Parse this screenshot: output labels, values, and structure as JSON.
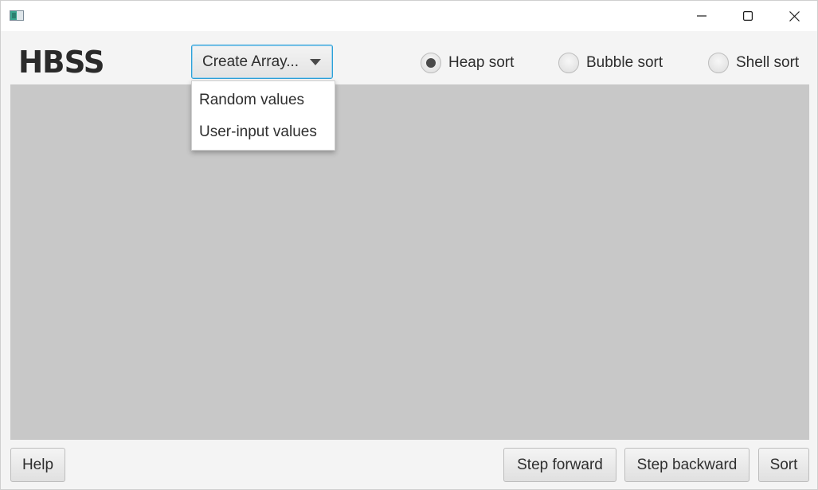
{
  "window": {
    "app_icon": "app-window-icon",
    "controls": {
      "minimize": "minimize-icon",
      "maximize": "maximize-icon",
      "close": "close-icon"
    }
  },
  "header": {
    "logo": "HBSS",
    "create_array": {
      "label": "Create Array...",
      "icon": "chevron-down-icon",
      "options": [
        "Random values",
        "User-input values"
      ],
      "expanded": true
    },
    "sort_modes": [
      {
        "label": "Heap sort",
        "selected": true
      },
      {
        "label": "Bubble sort",
        "selected": false
      },
      {
        "label": "Shell sort",
        "selected": false
      }
    ]
  },
  "canvas": {
    "background": "#c8c8c8"
  },
  "footer": {
    "help": "Help",
    "step_forward": "Step forward",
    "step_backward": "Step backward",
    "sort": "Sort"
  },
  "colors": {
    "accent_focus": "#2ba0d8",
    "window_bg": "#f4f4f4"
  }
}
